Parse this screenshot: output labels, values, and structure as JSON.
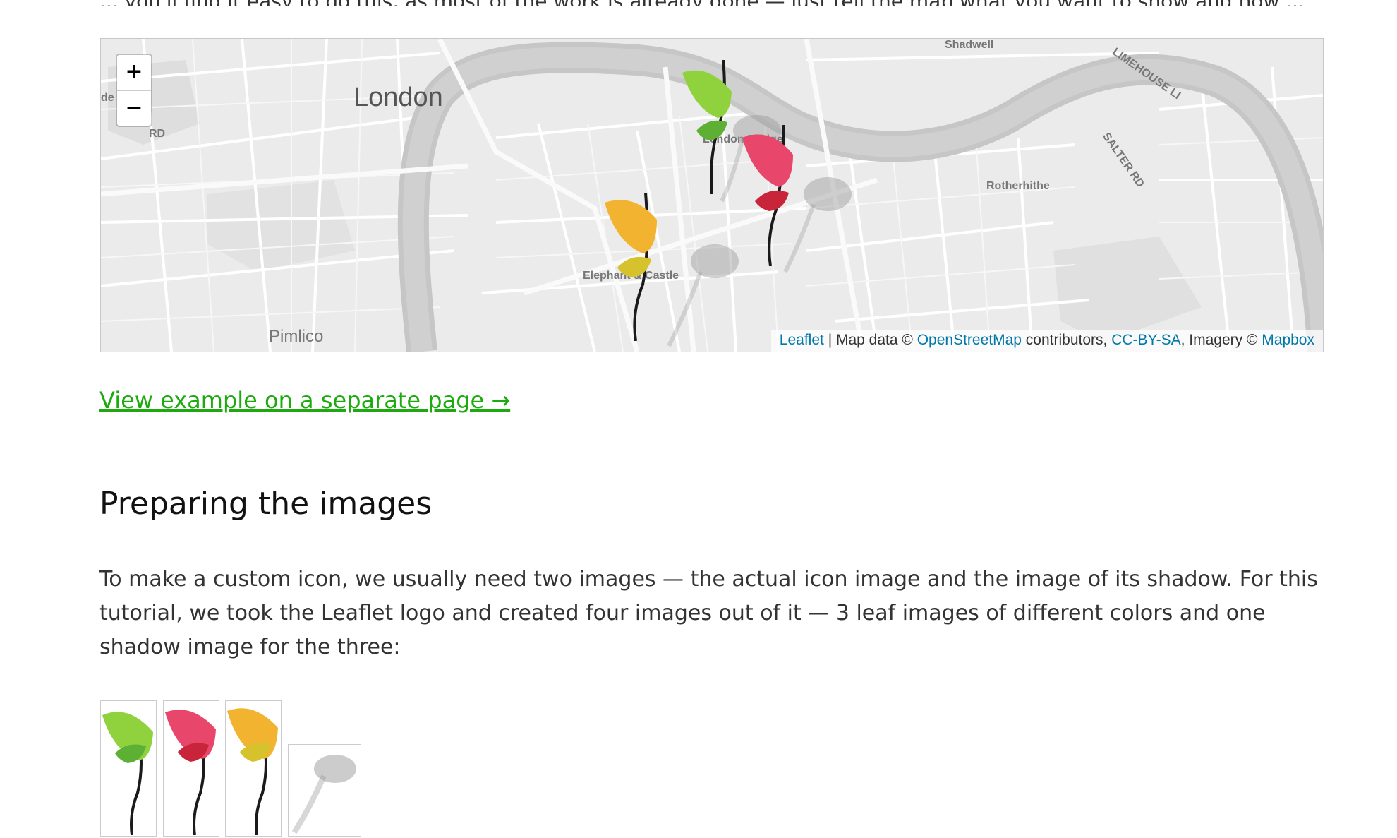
{
  "intro_line": "... you'll find it easy to do this, as most of the work is already done — just tell the map what you want to show and how ...",
  "map": {
    "labels": {
      "london": "London",
      "pimlico": "Pimlico",
      "shadwell": "Shadwell",
      "rotherhithe": "Rotherhithe",
      "london_bridge": "London Bridge",
      "elephant_castle": "Elephant & Castle",
      "salter_rd": "SALTER RD",
      "limehouse": "LIMEHOUSE LI",
      "rd_left": "RD",
      "de_left": "de"
    },
    "zoom_in": "+",
    "zoom_out": "−",
    "attribution": {
      "leaflet": "Leaflet",
      "sep1": " | Map data © ",
      "osm": "OpenStreetMap",
      "sep2": " contributors, ",
      "license": "CC-BY-SA",
      "sep3": ", Imagery © ",
      "mapbox": "Mapbox"
    },
    "markers": [
      {
        "name": "green-leaf-marker",
        "color": "#8fd23e"
      },
      {
        "name": "red-leaf-marker",
        "color": "#e8466a"
      },
      {
        "name": "orange-leaf-marker",
        "color": "#f2b430"
      }
    ]
  },
  "separate_page_link": "View example on a separate page →",
  "section_heading": "Preparing the images",
  "body_text": "To make a custom icon, we usually need two images — the actual icon image and the image of its shadow. For this tutorial, we took the Leaflet logo and created four images out of it — 3 leaf images of different colors and one shadow image for the three:",
  "colors": {
    "link_green": "#1daa0f",
    "attribution_link": "#0078a8",
    "leaf_green": "#8fd23e",
    "leaf_red": "#e8466a",
    "leaf_orange": "#f2b430",
    "river": "#c6c6c6"
  }
}
